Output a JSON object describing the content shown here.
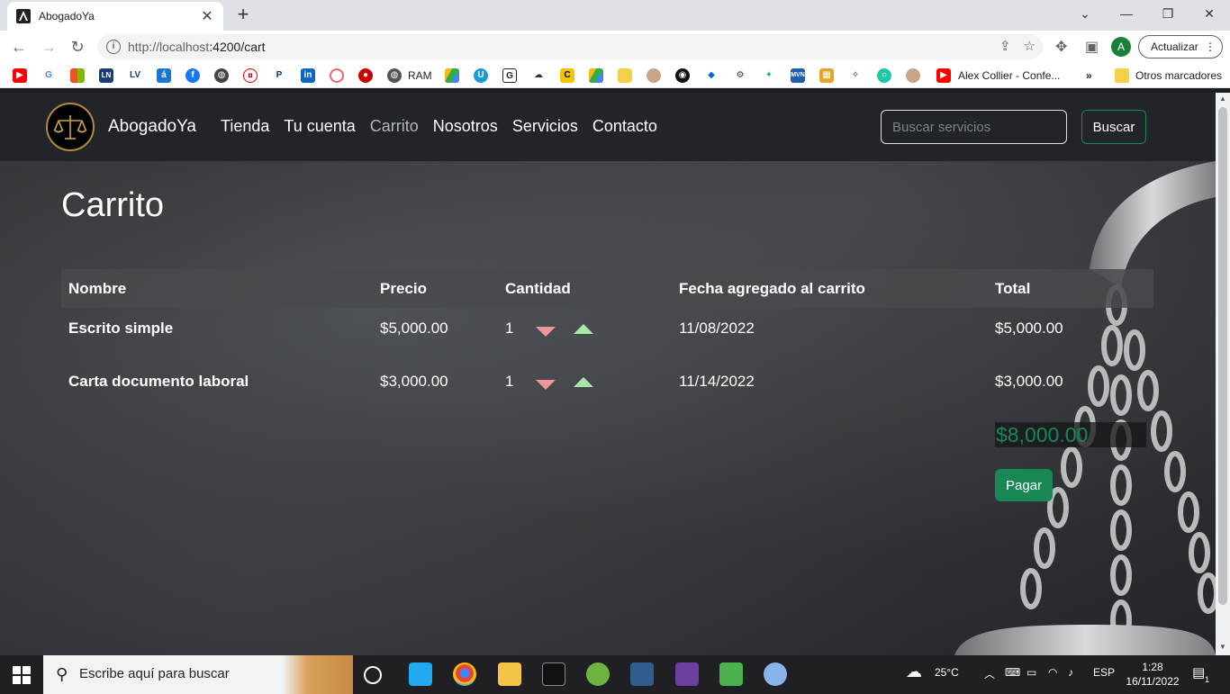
{
  "browser": {
    "tab_title": "AbogadoYa",
    "url_host": "http://localhost",
    "url_path": ":4200/cart",
    "update_label": "Actualizar",
    "profile_initial": "A",
    "bookmarks": {
      "ram_label": "RAM",
      "youtube_label": "Alex Collier - Confe...",
      "other_label": "Otros marcadores"
    }
  },
  "navbar": {
    "brand": "AbogadoYa",
    "links": [
      "Tienda",
      "Tu cuenta",
      "Carrito",
      "Nosotros",
      "Servicios",
      "Contacto"
    ],
    "active_link": "Carrito",
    "search_placeholder": "Buscar servicios",
    "search_button": "Buscar"
  },
  "cart": {
    "title": "Carrito",
    "columns": [
      "Nombre",
      "Precio",
      "Cantidad",
      "Fecha agregado al carrito",
      "Total"
    ],
    "rows": [
      {
        "name": "Escrito simple",
        "price": "$5,000.00",
        "qty": "1",
        "date": "11/08/2022",
        "total": "$5,000.00"
      },
      {
        "name": "Carta documento laboral",
        "price": "$3,000.00",
        "qty": "1",
        "date": "11/14/2022",
        "total": "$3,000.00"
      }
    ],
    "grand_total": "$8,000.00",
    "pay_button": "Pagar",
    "colors": {
      "accent": "#198754",
      "decrease": "#f1959a",
      "increase": "#a6e9a7"
    }
  },
  "taskbar": {
    "search_placeholder": "Escribe aquí para buscar",
    "temperature": "25°C",
    "language": "ESP",
    "time": "1:28",
    "date": "16/11/2022",
    "notifications": "1"
  }
}
